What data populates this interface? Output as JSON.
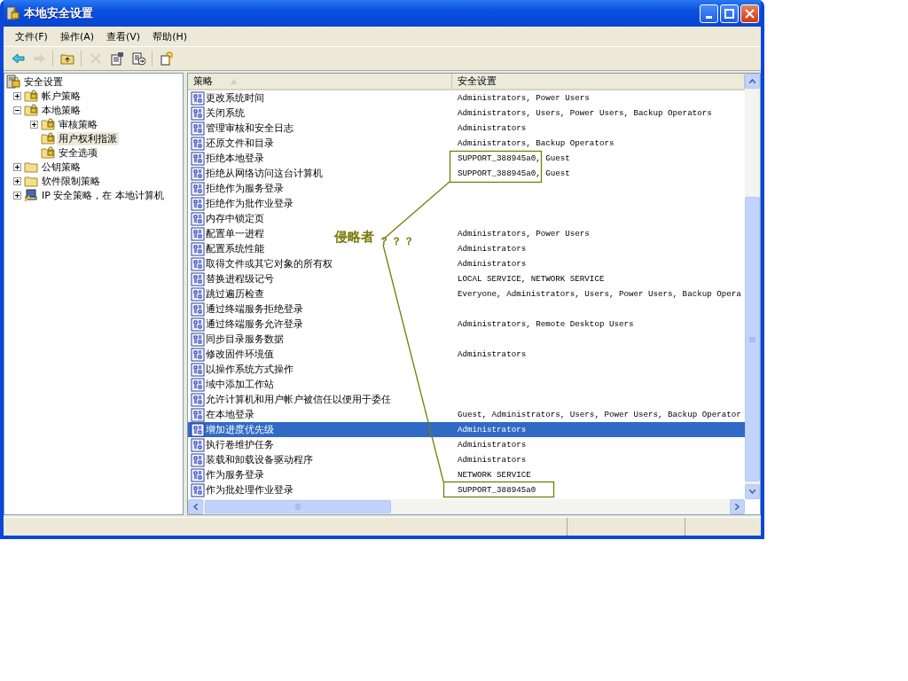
{
  "window": {
    "title": "本地安全设置"
  },
  "menu": [
    "文件(F)",
    "操作(A)",
    "查看(V)",
    "帮助(H)"
  ],
  "toolbar": [
    {
      "kind": "back",
      "disabled": false
    },
    {
      "kind": "forward",
      "disabled": true
    },
    {
      "kind": "sep"
    },
    {
      "kind": "up",
      "disabled": false
    },
    {
      "kind": "sep"
    },
    {
      "kind": "delete",
      "disabled": true
    },
    {
      "kind": "properties",
      "disabled": false
    },
    {
      "kind": "export",
      "disabled": false
    },
    {
      "kind": "sep"
    },
    {
      "kind": "help",
      "disabled": false
    }
  ],
  "tree": [
    {
      "label": "安全设置",
      "kind": "root",
      "selected": false,
      "children": [
        {
          "label": "帐户策略",
          "kind": "lockfolder",
          "selected": false,
          "expanded": false
        },
        {
          "label": "本地策略",
          "kind": "lockfolder",
          "selected": false,
          "expanded": true,
          "children": [
            {
              "label": "审核策略",
              "kind": "lockfolder",
              "selected": false,
              "expanded": false
            },
            {
              "label": "用户权利指派",
              "kind": "lockfolder",
              "selected": true
            },
            {
              "label": "安全选项",
              "kind": "lockfolder",
              "selected": false
            }
          ]
        },
        {
          "label": "公钥策略",
          "kind": "folder",
          "selected": false,
          "expanded": false
        },
        {
          "label": "软件限制策略",
          "kind": "folder",
          "selected": false,
          "expanded": false
        },
        {
          "label": "IP 安全策略，在 本地计算机",
          "kind": "ipsec",
          "selected": false,
          "expanded": false
        }
      ]
    }
  ],
  "table": {
    "columns": [
      "策略",
      "安全设置"
    ],
    "rows": [
      {
        "policy": "更改系统时间",
        "setting": "Administrators, Power Users",
        "selected": false
      },
      {
        "policy": "关闭系统",
        "setting": "Administrators, Users, Power Users, Backup Operators",
        "selected": false
      },
      {
        "policy": "管理审核和安全日志",
        "setting": "Administrators",
        "selected": false
      },
      {
        "policy": "还原文件和目录",
        "setting": "Administrators, Backup Operators",
        "selected": false
      },
      {
        "policy": "拒绝本地登录",
        "setting": "SUPPORT_388945a0, Guest",
        "selected": false
      },
      {
        "policy": "拒绝从网络访问这台计算机",
        "setting": "SUPPORT_388945a0, Guest",
        "selected": false
      },
      {
        "policy": "拒绝作为服务登录",
        "selected": false
      },
      {
        "policy": "拒绝作为批作业登录",
        "selected": false
      },
      {
        "policy": "内存中锁定页",
        "selected": false
      },
      {
        "policy": "配置单一进程",
        "setting": "Administrators, Power Users",
        "selected": false
      },
      {
        "policy": "配置系统性能",
        "setting": "Administrators",
        "selected": false
      },
      {
        "policy": "取得文件或其它对象的所有权",
        "setting": "Administrators",
        "selected": false
      },
      {
        "policy": "替换进程级记号",
        "setting": "LOCAL SERVICE, NETWORK SERVICE",
        "selected": false
      },
      {
        "policy": "跳过遍历检查",
        "setting": "Everyone, Administrators, Users, Power Users, Backup Opera",
        "selected": false
      },
      {
        "policy": "通过终端服务拒绝登录",
        "selected": false
      },
      {
        "policy": "通过终端服务允许登录",
        "setting": "Administrators, Remote Desktop Users",
        "selected": false
      },
      {
        "policy": "同步目录服务数据",
        "selected": false
      },
      {
        "policy": "修改固件环境值",
        "setting": "Administrators",
        "selected": false
      },
      {
        "policy": "以操作系统方式操作",
        "selected": false
      },
      {
        "policy": "域中添加工作站",
        "selected": false
      },
      {
        "policy": "允许计算机和用户帐户被信任以便用于委任",
        "selected": false
      },
      {
        "policy": "在本地登录",
        "setting": "Guest, Administrators, Users, Power Users, Backup Operator",
        "selected": false
      },
      {
        "policy": "增加进度优先级",
        "setting": "Administrators",
        "selected": true
      },
      {
        "policy": "执行卷维护任务",
        "setting": "Administrators",
        "selected": false
      },
      {
        "policy": "装载和卸载设备驱动程序",
        "setting": "Administrators",
        "selected": false
      },
      {
        "policy": "作为服务登录",
        "setting": "NETWORK SERVICE",
        "selected": false
      },
      {
        "policy": "作为批处理作业登录",
        "setting": "SUPPORT_388945a0",
        "selected": false
      }
    ]
  },
  "annotation": {
    "label": "侵略者",
    "marks": "？？？"
  }
}
